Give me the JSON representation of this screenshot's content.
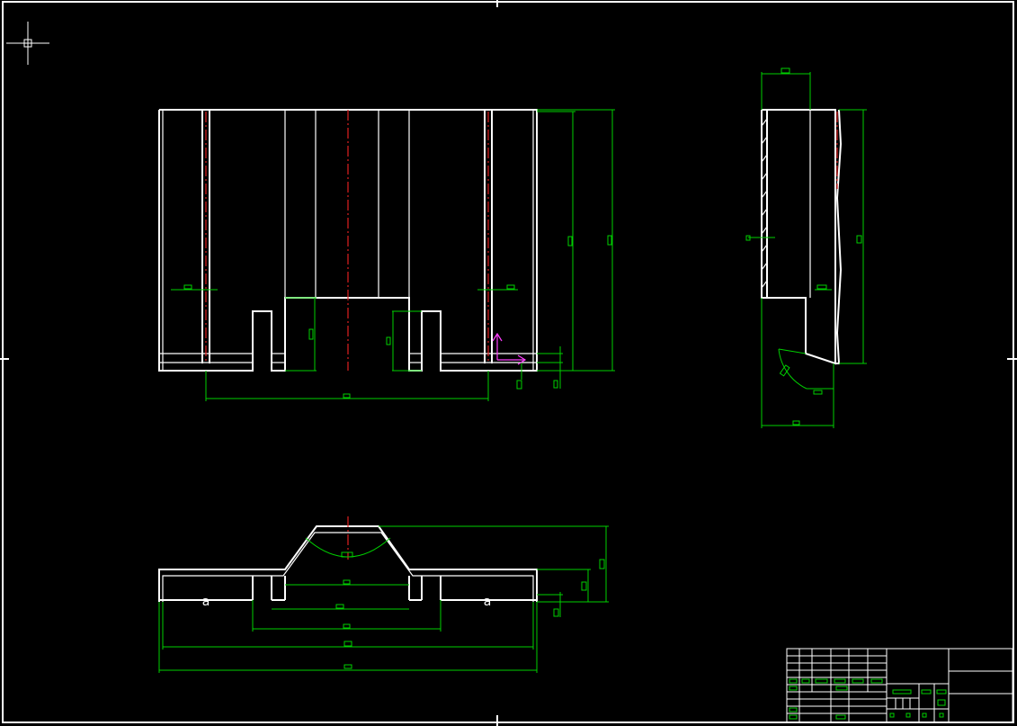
{
  "app": {
    "title": "",
    "background": "#000000",
    "colors": {
      "geometry": "#ffffff",
      "dimension": "#00d000",
      "centerline": "#e02020",
      "ucs": "#ff40ff"
    }
  },
  "icons": {
    "crosshair": "crosshair-cursor-icon",
    "ucs": "ucs-axis-icon"
  },
  "views": [
    {
      "name": "front-view"
    },
    {
      "name": "side-view"
    },
    {
      "name": "bottom-view"
    }
  ],
  "callouts": {
    "left_hole": "a",
    "right_hole": "a"
  }
}
